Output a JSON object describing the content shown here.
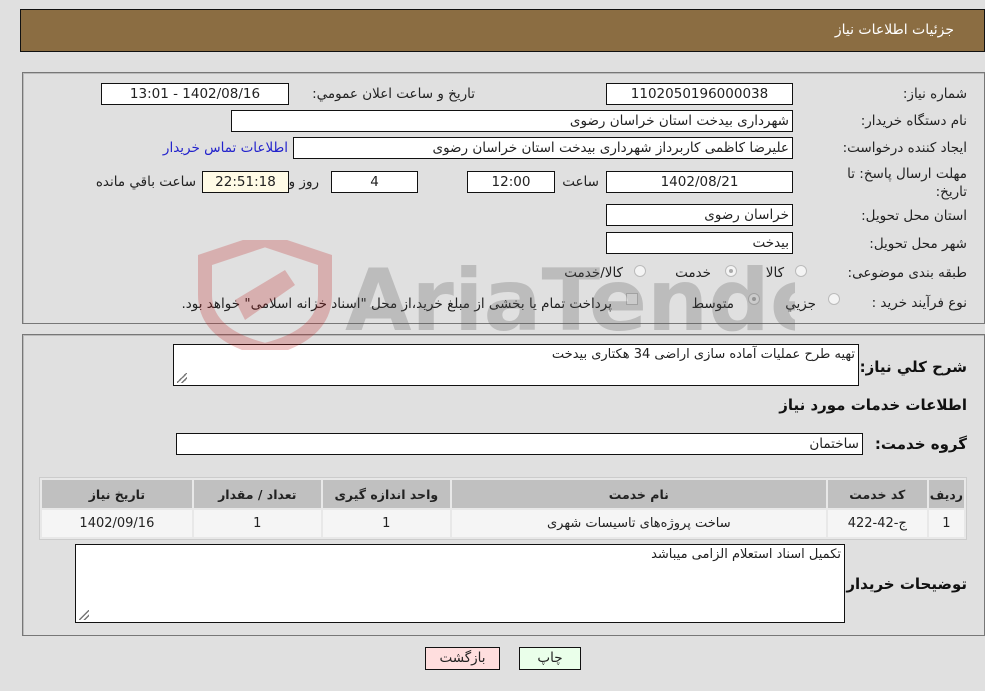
{
  "header": {
    "title": "جزئیات اطلاعات نیاز"
  },
  "fields": {
    "need_number": {
      "label": "شماره نیاز:",
      "value": "1102050196000038"
    },
    "announce_datetime": {
      "label": "تاریخ و ساعت اعلان عمومي:",
      "value": "1402/08/16 - 13:01"
    },
    "buyer_org": {
      "label": "نام دستگاه خریدار:",
      "value": "شهرداری بیدخت استان خراسان رضوی"
    },
    "requester": {
      "label": "ایجاد کننده درخواست:",
      "value": "علیرضا کاظمی کاربرداز شهرداری بیدخت استان خراسان رضوی"
    },
    "buyer_contact_link": "اطلاعات تماس خریدار",
    "deadline": {
      "label": "مهلت ارسال پاسخ: تا تاریخ:",
      "date": "1402/08/21",
      "time_label": "ساعت",
      "time": "12:00",
      "days": "4",
      "days_label": "روز و",
      "remaining": "22:51:18",
      "remaining_label": "ساعت باقي مانده"
    },
    "delivery_province": {
      "label": "استان محل تحویل:",
      "value": "خراسان رضوی"
    },
    "delivery_city": {
      "label": "شهر محل تحویل:",
      "value": "بیدخت"
    },
    "category": {
      "label": "طبقه بندی موضوعی:",
      "options": [
        "کالا",
        "خدمت",
        "کالا/خدمت"
      ],
      "selected": "خدمت"
    },
    "purchase_process": {
      "label": "نوع فرآیند خرید :",
      "options": [
        "جزيي",
        "متوسط"
      ],
      "selected": "متوسط",
      "treasury_note": "پرداخت تمام یا بخشی از مبلغ خرید،از محل \"اسناد خزانه اسلامی\" خواهد بود."
    }
  },
  "description": {
    "label": "شرح کلي نیاز:",
    "value": "تهیه  طرح عملیات آماده سازی اراضی 34 هکتاری بیدخت"
  },
  "services_section_title": "اطلاعات خدمات مورد نیاز",
  "service_group": {
    "label": "گروه خدمت:",
    "value": "ساختمان"
  },
  "table": {
    "headers": [
      "ردیف",
      "کد خدمت",
      "نام خدمت",
      "واحد اندازه گیری",
      "تعداد / مقدار",
      "تاریخ نیاز"
    ],
    "rows": [
      [
        "1",
        "ج-42-422",
        "ساخت پروژه‌های تاسیسات شهری",
        "1",
        "1",
        "1402/09/16"
      ]
    ]
  },
  "buyer_notes": {
    "label": "توضیحات خریدار:",
    "value": "تکمیل اسناد استعلام الزامی میباشد"
  },
  "buttons": {
    "print": "چاپ",
    "back": "بازگشت"
  },
  "colors": {
    "header_bg": "#8b6d42",
    "print_bg": "#eaffea",
    "back_bg": "#ffdede",
    "link": "#2323cc"
  }
}
